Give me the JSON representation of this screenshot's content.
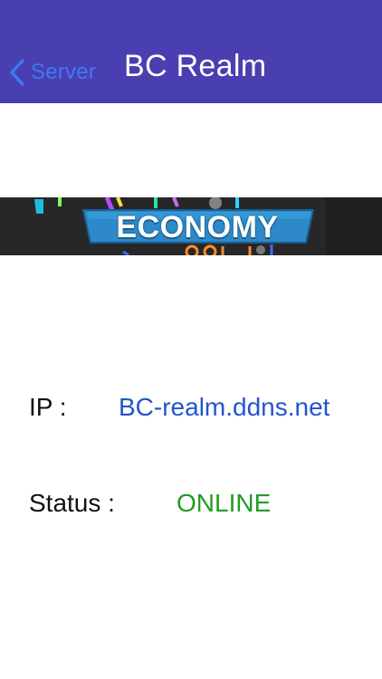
{
  "navbar": {
    "back_label": "Server",
    "title": "BC Realm",
    "background_color": "#4a3fb0",
    "back_color": "#3b7bf5"
  },
  "banner": {
    "text": "ECONOMY"
  },
  "details": {
    "ip_label": "IP :",
    "ip_value": "BC-realm.ddns.net",
    "status_label": "Status :",
    "status_value": "ONLINE",
    "ip_color": "#2255cc",
    "status_color": "#229c22"
  }
}
